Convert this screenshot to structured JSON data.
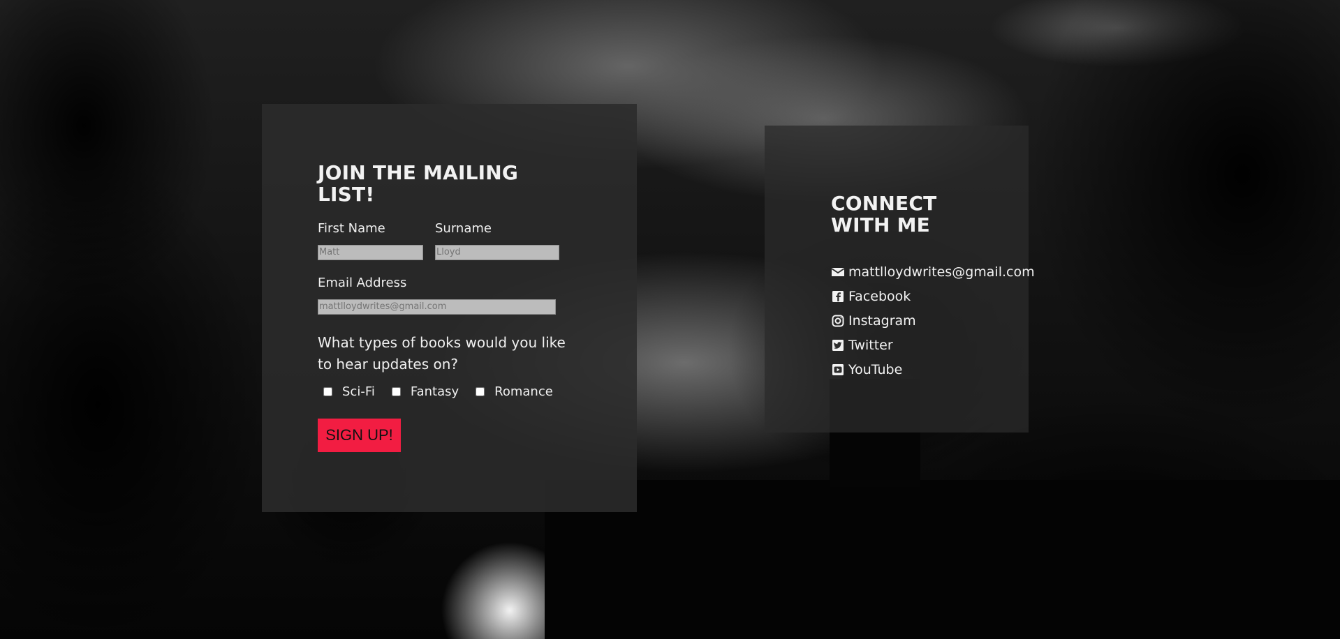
{
  "mailing": {
    "title": "JOIN THE MAILING LIST!",
    "first_name_label": "First Name",
    "first_name_placeholder": "Matt",
    "surname_label": "Surname",
    "surname_placeholder": "Lloyd",
    "email_label": "Email Address",
    "email_placeholder": "mattlloydwrites@gmail.com",
    "question": "What types of books would you like to hear updates on?",
    "options": [
      {
        "label": "Sci-Fi"
      },
      {
        "label": "Fantasy"
      },
      {
        "label": "Romance"
      }
    ],
    "signup_label": "SIGN UP!"
  },
  "connect": {
    "title": "CONNECT WITH ME",
    "items": [
      {
        "label": "mattlloydwrites@gmail.com",
        "icon": "envelope-icon"
      },
      {
        "label": "Facebook",
        "icon": "facebook-icon"
      },
      {
        "label": "Instagram",
        "icon": "instagram-icon"
      },
      {
        "label": "Twitter",
        "icon": "twitter-icon"
      },
      {
        "label": "YouTube",
        "icon": "youtube-icon"
      }
    ]
  },
  "colors": {
    "accent": "#f21d42",
    "panel": "#2b2b2b",
    "text": "#f0f0f0"
  }
}
